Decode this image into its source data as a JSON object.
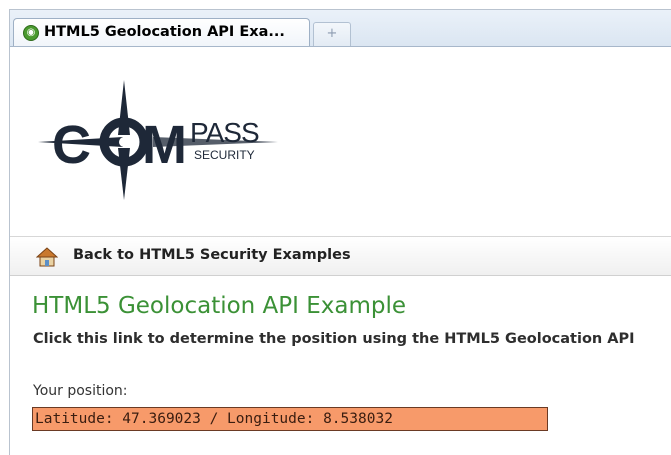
{
  "browser": {
    "tab_title": "HTML5 Geolocation API Exa...",
    "tab_icon": "compass-favicon-icon",
    "new_tab_icon": "plus-icon"
  },
  "logo": {
    "letters_left": "C",
    "letters_mid": "M",
    "word_top": "PASS",
    "word_bottom": "SECURITY"
  },
  "nav": {
    "back_label": "Back to HTML5 Security Examples",
    "icon": "home-icon"
  },
  "main": {
    "title": "HTML5 Geolocation API Example",
    "instruction": "Click this link to determine the position using the HTML5 Geolocation API",
    "position_label": "Your position:",
    "position_value": "Latitude: 47.369023 / Longitude: 8.538032"
  },
  "colors": {
    "title_green": "#3b9136",
    "position_bg": "#f79a6a"
  }
}
